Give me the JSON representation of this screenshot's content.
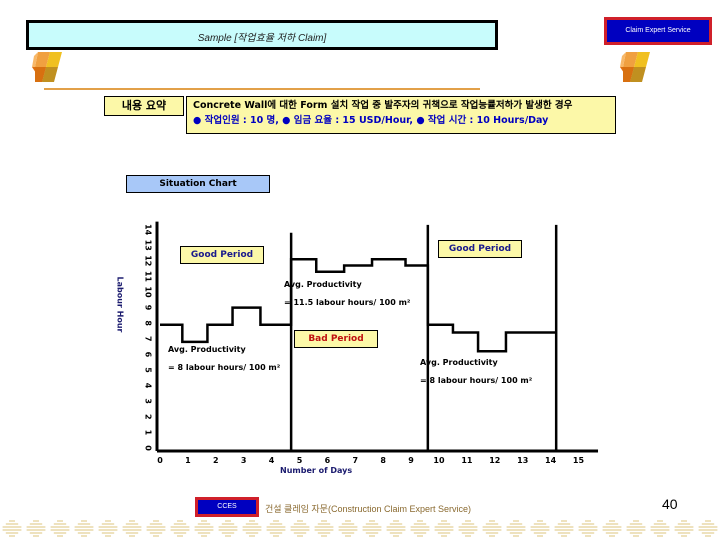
{
  "header": {
    "title": "Sample [작업효율 저하 Claim]",
    "brand": "Claim Expert Service"
  },
  "summary": {
    "label": "내용 요약",
    "line1": "Concrete Wall에 대한 Form 설치 작업 중 발주자의 귀책으로 작업능률저하가 발생한 경우",
    "line2": "● 작업인원 : 10 명, ● 임금 요율 : 15 USD/Hour, ● 작업 시간 : 10 Hours/Day"
  },
  "section_label": "Situation Chart",
  "chart_data": {
    "type": "line",
    "title": "Situation Chart",
    "xlabel": "Number of Days",
    "ylabel": "Labour Hour",
    "xlim": [
      0,
      15.7
    ],
    "ylim": [
      0,
      14
    ],
    "x_ticks": [
      "0",
      "1",
      "2",
      "3",
      "4",
      "5",
      "6",
      "7",
      "8",
      "9",
      "10",
      "11",
      "12",
      "13",
      "14",
      "15"
    ],
    "y_ticks": [
      "0",
      "1",
      "2",
      "3",
      "4",
      "5",
      "6",
      "7",
      "8",
      "9",
      "10",
      "11",
      "12",
      "13",
      "14"
    ],
    "grid": false,
    "period_dividers": [
      4.7,
      9.6,
      14.2
    ],
    "series": [
      {
        "name": "Labour hours (step)",
        "x": [
          0,
          0.8,
          0.8,
          1.7,
          1.7,
          2.6,
          2.6,
          3.6,
          3.6,
          4.7,
          4.7,
          5.6,
          5.6,
          6.6,
          6.6,
          7.6,
          7.6,
          8.8,
          8.8,
          9.6,
          9.6,
          10.5,
          10.5,
          11.4,
          11.4,
          12.4,
          12.4,
          14.2
        ],
        "y": [
          7.9,
          7.9,
          6.8,
          6.8,
          7.9,
          7.9,
          9.0,
          9.0,
          7.9,
          7.9,
          12.1,
          12.1,
          11.3,
          11.3,
          11.7,
          11.7,
          12.1,
          12.1,
          11.7,
          11.7,
          7.9,
          7.9,
          7.4,
          7.4,
          6.2,
          6.2,
          7.4,
          7.4
        ]
      }
    ],
    "annotations": [
      {
        "label": "Good Period",
        "region": 1
      },
      {
        "label": "Bad Period",
        "region": 2
      },
      {
        "label": "Good Period",
        "region": 3
      },
      {
        "text_line1": "Avg. Productivity",
        "text_line2": "= 8 labour hours/ 100 m²",
        "region": 1
      },
      {
        "text_line1": "Avg. Productivity",
        "text_line2": "= 11.5 labour hours/ 100 m²",
        "region": 2
      },
      {
        "text_line1": "Avg. Productivity",
        "text_line2": "= 8 labour hours/ 100 m²",
        "region": 3
      }
    ]
  },
  "periods": {
    "good1": "Good Period",
    "bad": "Bad Period",
    "good2": "Good Period"
  },
  "avg": {
    "r1_l1": "Avg. Productivity",
    "r1_l2": "= 8 labour hours/ 100 m²",
    "r2_l1": "Avg. Productivity",
    "r2_l2": "= 11.5 labour hours/ 100 m²",
    "r3_l1": "Avg. Productivity",
    "r3_l2": "= 8 labour hours/ 100 m²"
  },
  "axes": {
    "xlabel": "Number of Days",
    "ylabel": "Labour Hour"
  },
  "footer": {
    "badge": "CCES",
    "text": "건설 클레임 자문(Construction Claim Expert Service)",
    "page_number": "40"
  },
  "colors": {
    "title_bg": "#c8fcfc",
    "brand_bg": "#0000c0",
    "brand_border": "#d0202a",
    "summary_bg": "#fcf8a8",
    "situation_bg": "#a8c8f8",
    "good_text": "#1a1a8c",
    "bad_text": "#c01010"
  }
}
